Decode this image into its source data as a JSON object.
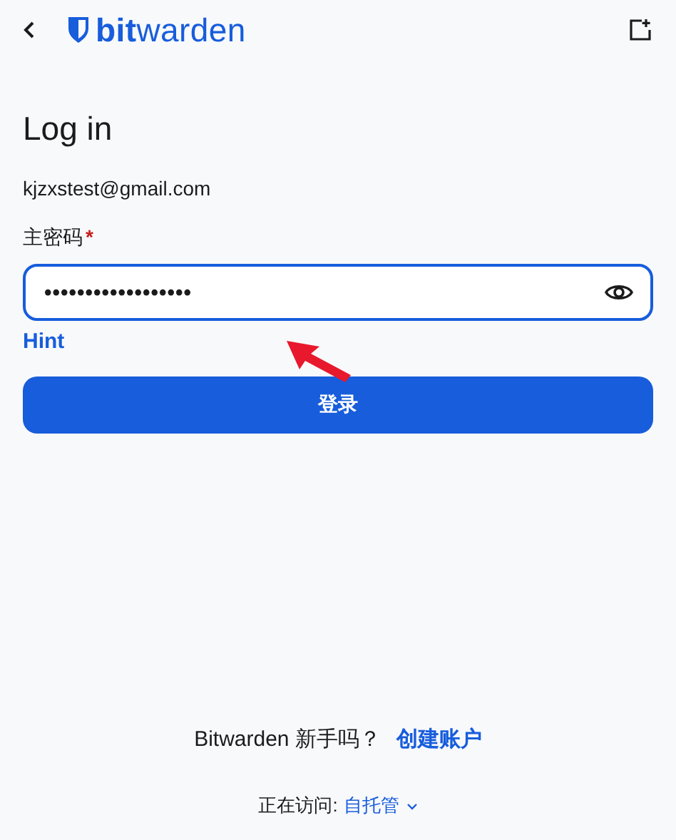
{
  "header": {
    "logo": "**bit**warden"
  },
  "title": "Log in",
  "email": "kjzxstest@gmail.com",
  "password_field": {
    "label": "主密码",
    "required_mark": "*",
    "value": "••••••••••••••••••",
    "focused": true
  },
  "hint_link": "Hint",
  "login_button": "登录",
  "signup": {
    "text": "Bitwarden 新手吗？",
    "link": "创建账户"
  },
  "region": {
    "label": "正在访问:",
    "value": "自托管"
  }
}
